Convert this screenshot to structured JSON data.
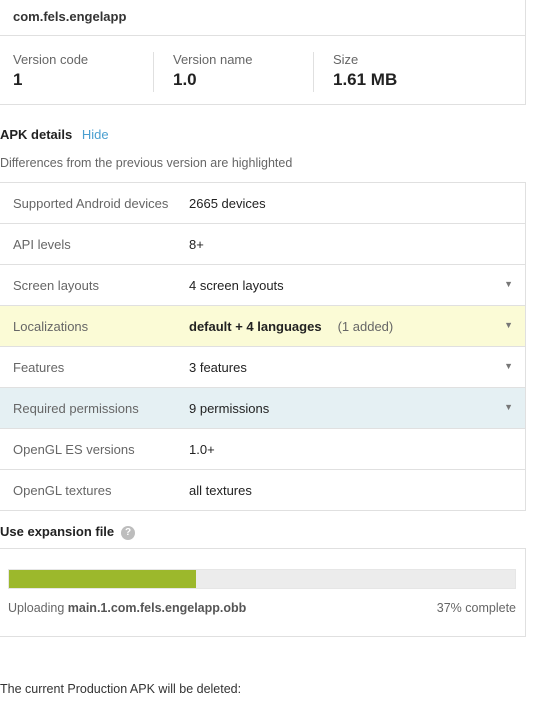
{
  "package": {
    "name": "com.fels.engelapp",
    "stats": [
      {
        "label": "Version code",
        "value": "1"
      },
      {
        "label": "Version name",
        "value": "1.0"
      },
      {
        "label": "Size",
        "value": "1.61 MB"
      }
    ]
  },
  "apk_details": {
    "title": "APK details",
    "hide_label": "Hide",
    "note": "Differences from the previous version are highlighted",
    "rows": [
      {
        "key": "Supported Android devices",
        "value": "2665 devices"
      },
      {
        "key": "API levels",
        "value": "8+"
      },
      {
        "key": "Screen layouts",
        "value": "4 screen layouts"
      },
      {
        "key": "Localizations",
        "value": "default + 4 languages",
        "extra": "(1 added)"
      },
      {
        "key": "Features",
        "value": "3 features"
      },
      {
        "key": "Required permissions",
        "value": "9 permissions"
      },
      {
        "key": "OpenGL ES versions",
        "value": "1.0+"
      },
      {
        "key": "OpenGL textures",
        "value": "all textures"
      }
    ],
    "caret": "▼"
  },
  "expansion": {
    "title": "Use expansion file",
    "help_glyph": "?",
    "uploading_label": "Uploading",
    "file_name": "main.1.com.fels.engelapp.obb",
    "progress_text": "37% complete",
    "progress_fraction": 0.37,
    "bar_color": "#9cb82c"
  },
  "production_note": "The current Production APK will be deleted:"
}
